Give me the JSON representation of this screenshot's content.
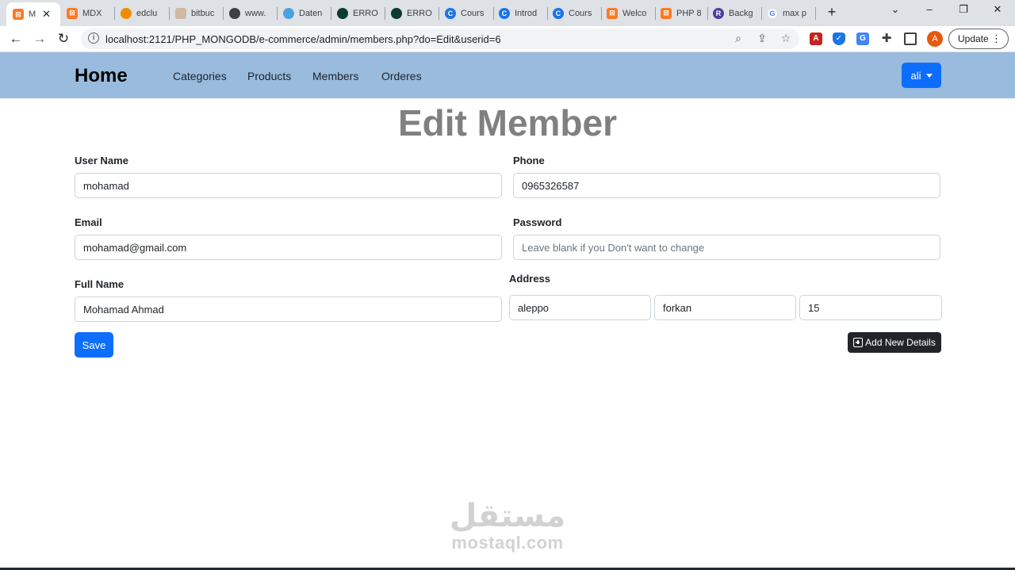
{
  "browser": {
    "tabs": [
      {
        "label": "M",
        "icon": "xampp-icon",
        "color": "#fb7a24",
        "active": true
      },
      {
        "label": "MDX",
        "icon": "xampp-icon",
        "color": "#fb7a24"
      },
      {
        "label": "edclu",
        "icon": "edclub-icon",
        "color": "#f28b00"
      },
      {
        "label": "bitbuc",
        "icon": "bitbucket-icon",
        "color": "#d0b9a0"
      },
      {
        "label": "www.",
        "icon": "site-icon",
        "color": "#3c4043"
      },
      {
        "label": "Daten",
        "icon": "database-icon",
        "color": "#4aa3df"
      },
      {
        "label": "ERRO",
        "icon": "mongodb-icon",
        "color": "#0b3d2e"
      },
      {
        "label": "ERRO",
        "icon": "mongodb-icon",
        "color": "#0b3d2e"
      },
      {
        "label": "Cours",
        "icon": "course-icon",
        "color": "#1a73e8"
      },
      {
        "label": "Introd",
        "icon": "course-icon",
        "color": "#1a73e8"
      },
      {
        "label": "Cours",
        "icon": "course-icon",
        "color": "#1a73e8"
      },
      {
        "label": "Welco",
        "icon": "xampp-icon",
        "color": "#fb7a24"
      },
      {
        "label": "PHP 8",
        "icon": "xampp-icon",
        "color": "#fb7a24"
      },
      {
        "label": "Backg",
        "icon": "r-icon",
        "color": "#4b3f9e"
      },
      {
        "label": "max p",
        "icon": "google-icon",
        "color": "#ffffff"
      }
    ],
    "url": "localhost:2121/PHP_MONGODB/e-commerce/admin/members.php?do=Edit&userid=6",
    "profile_initial": "A",
    "update_label": "Update"
  },
  "navbar": {
    "brand": "Home",
    "links": [
      "Categories",
      "Products",
      "Members",
      "Orderes"
    ],
    "user_label": "ali"
  },
  "page": {
    "title": "Edit Member"
  },
  "form": {
    "username": {
      "label": "User Name",
      "value": "mohamad"
    },
    "phone": {
      "label": "Phone",
      "value": "0965326587"
    },
    "email": {
      "label": "Email",
      "value": "mohamad@gmail.com"
    },
    "password": {
      "label": "Password",
      "value": "",
      "placeholder": "Leave blank if you Don't want to change"
    },
    "fullname": {
      "label": "Full Name",
      "value": "Mohamad Ahmad"
    },
    "address": {
      "label": "Address",
      "city": "aleppo",
      "street": "forkan",
      "number": "15"
    },
    "save_label": "Save",
    "add_details_label": "Add New Details"
  },
  "watermark": {
    "arabic": "مستقل",
    "latin": "mostaql.com"
  },
  "colors": {
    "navbar_bg": "#99bbdd",
    "primary": "#0d6efd",
    "dark": "#212529",
    "title_gray": "#808080"
  }
}
